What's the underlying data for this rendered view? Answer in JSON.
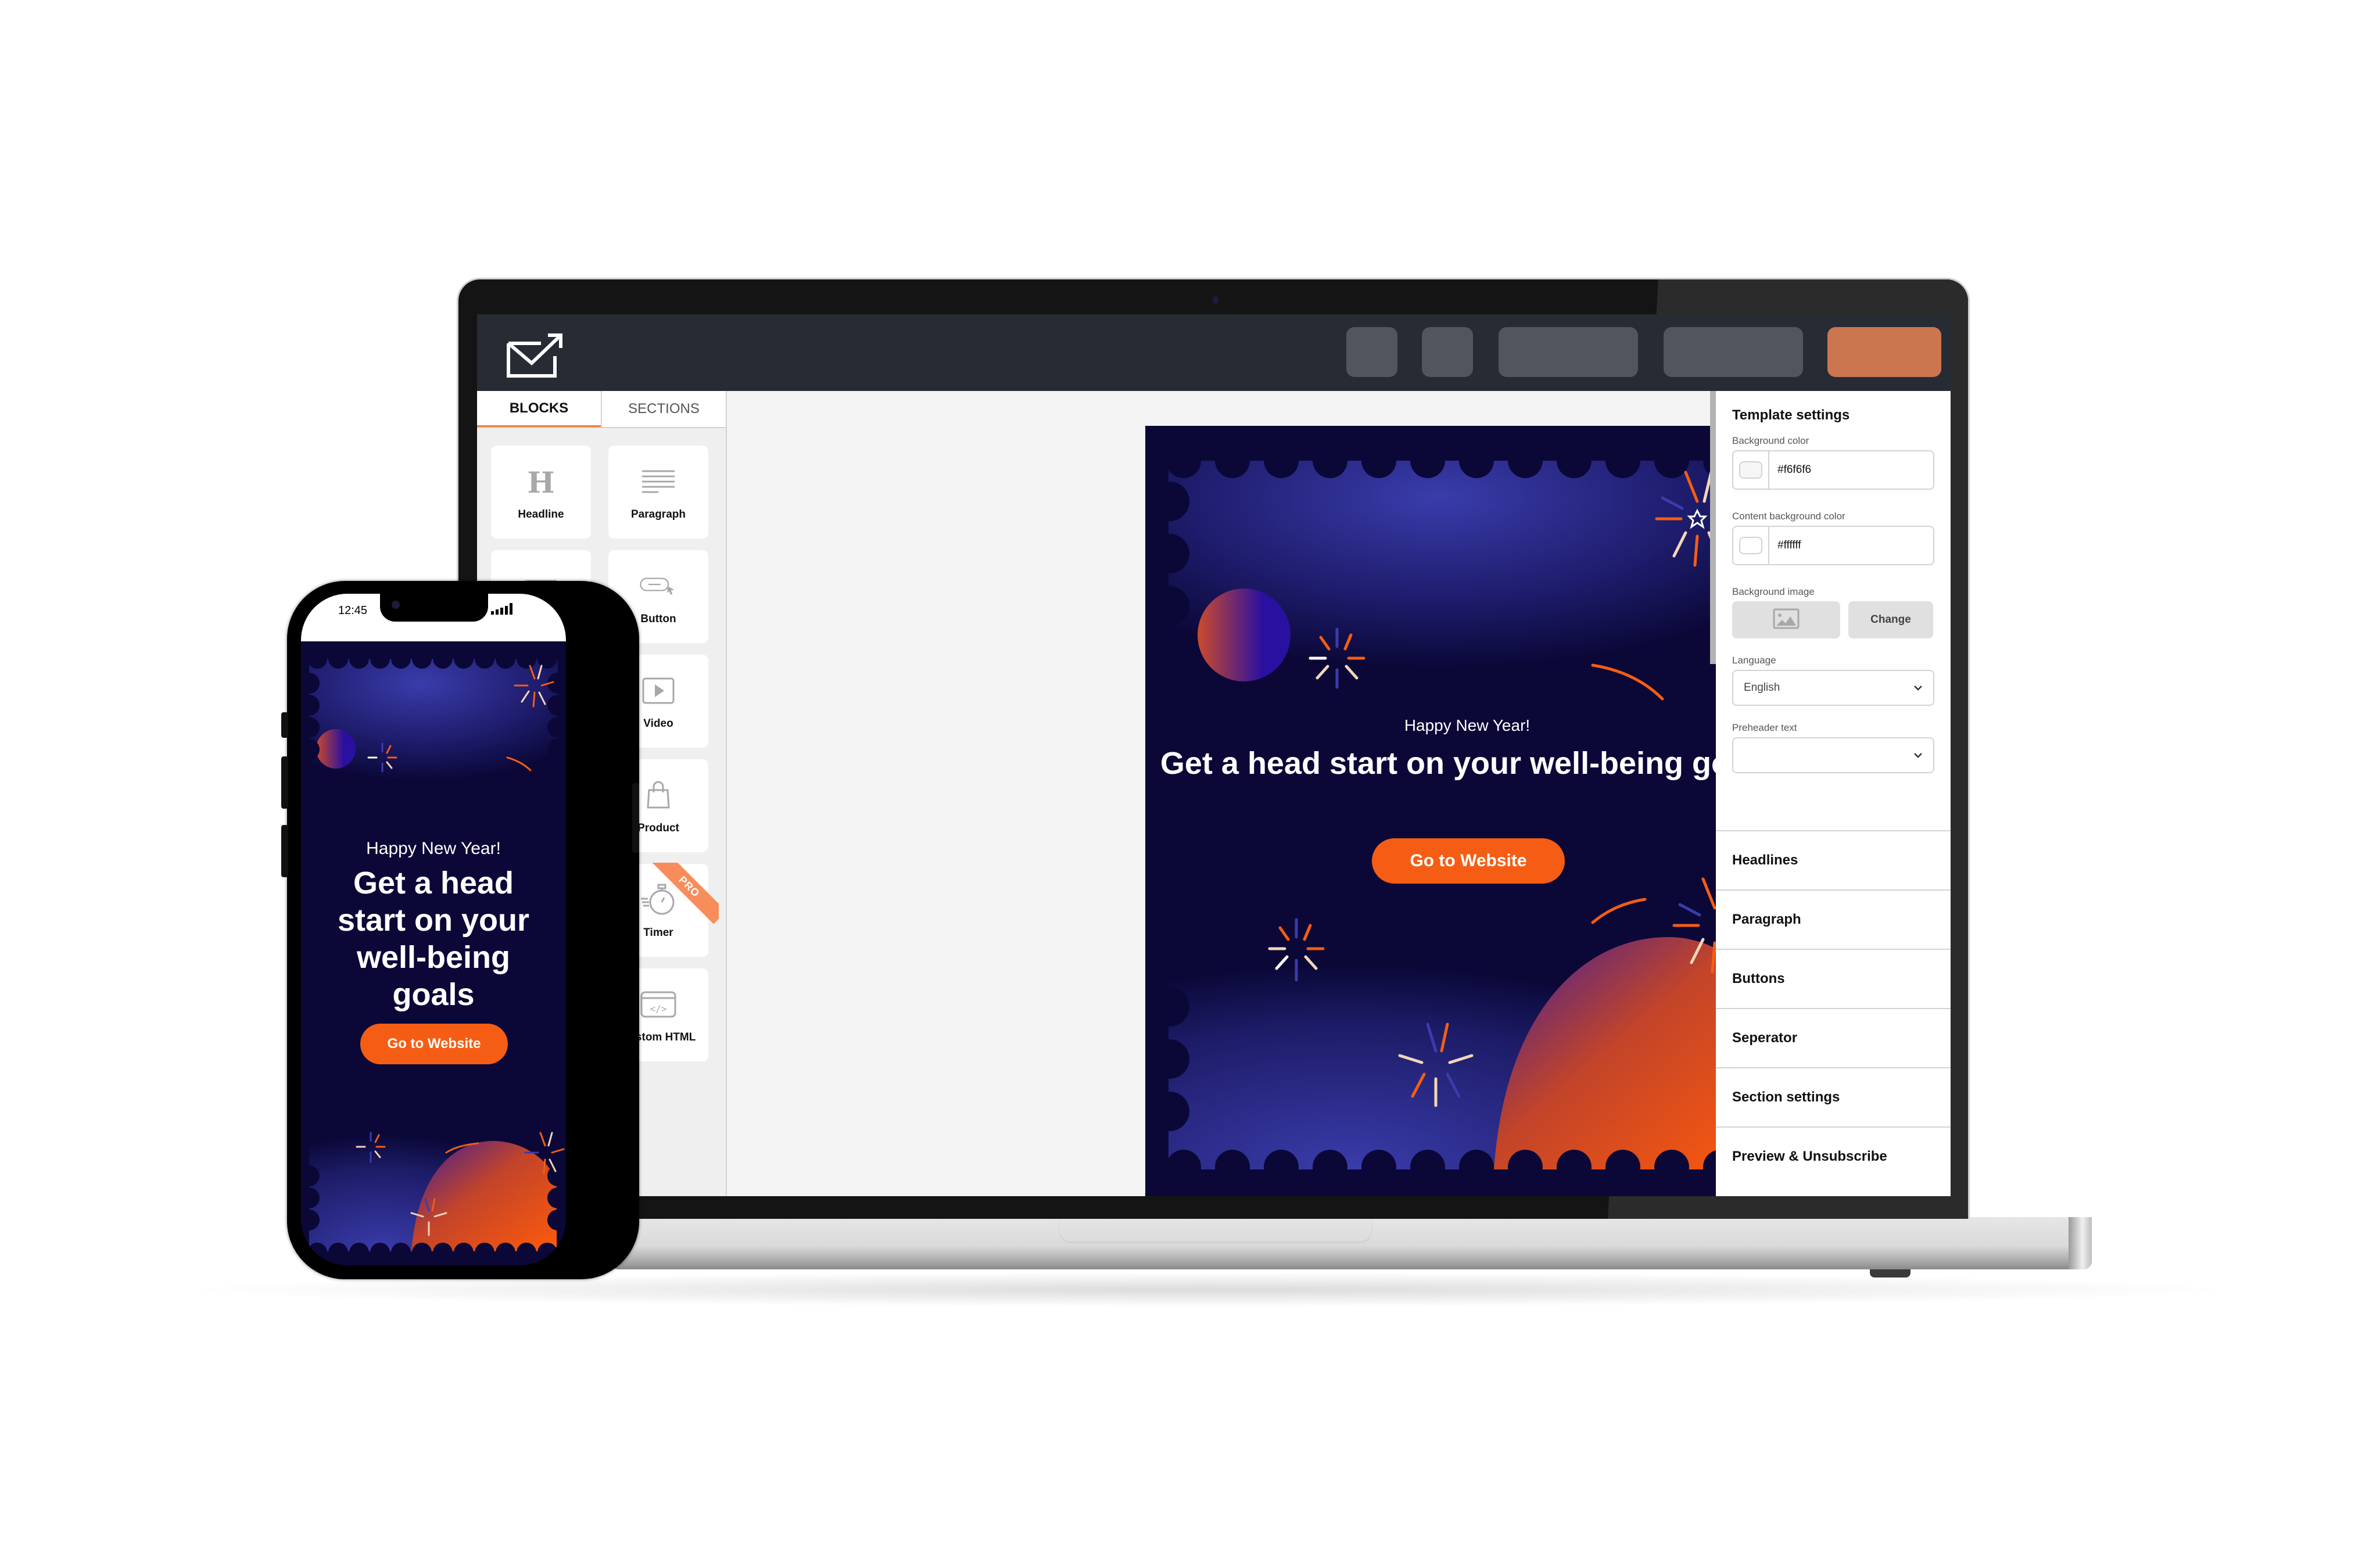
{
  "app": {
    "logo_icon": "envelope-send-icon",
    "toolbar_buttons": [
      {
        "label": "",
        "name": "toolbar-button-1"
      },
      {
        "label": "",
        "name": "toolbar-button-2"
      },
      {
        "label": "",
        "name": "toolbar-button-3"
      },
      {
        "label": "",
        "name": "toolbar-button-4"
      },
      {
        "label": "",
        "name": "toolbar-button-primary"
      }
    ],
    "colors": {
      "topbar": "#272b34",
      "accent": "#f37a3a",
      "primary_button": "#cc7650",
      "cta": "#f55d14",
      "email_bg": "#0b0838"
    }
  },
  "left_panel": {
    "tabs": [
      {
        "label": "BLOCKS",
        "active": true
      },
      {
        "label": "SECTIONS",
        "active": false
      }
    ],
    "blocks": [
      {
        "label": "Headline",
        "icon": "headline-icon"
      },
      {
        "label": "Paragraph",
        "icon": "paragraph-icon"
      },
      {
        "label": "",
        "icon": "image-icon"
      },
      {
        "label": "Button",
        "icon": "button-icon"
      },
      {
        "label": "",
        "icon": "block-icon"
      },
      {
        "label": "Video",
        "icon": "video-icon"
      },
      {
        "label": "",
        "icon": "block-icon"
      },
      {
        "label": "Product",
        "icon": "shopping-bag-icon"
      },
      {
        "label": "",
        "icon": "block-icon"
      },
      {
        "label": "Timer",
        "icon": "stopwatch-icon",
        "badge": "PRO"
      },
      {
        "label": "",
        "icon": "block-icon"
      },
      {
        "label": "Custom HTML",
        "icon": "code-icon"
      }
    ]
  },
  "email": {
    "greeting": "Happy New Year!",
    "headline": "Get a head start on your well-being goals",
    "cta_label": "Go to Website"
  },
  "right_panel": {
    "title": "Template settings",
    "background_color": {
      "label": "Background color",
      "value": "#f6f6f6"
    },
    "content_background_color": {
      "label": "Content background color",
      "value": "#ffffff"
    },
    "background_image": {
      "label": "Background image",
      "change_label": "Change"
    },
    "language": {
      "label": "Language",
      "value": "English"
    },
    "preheader": {
      "label": "Preheader text",
      "value": ""
    },
    "sections": [
      "Headlines",
      "Paragraph",
      "Buttons",
      "Seperator",
      "Section settings",
      "Preview & Unsubscribe"
    ]
  },
  "phone": {
    "time": "12:45",
    "greeting": "Happy New Year!",
    "headline": "Get a head start on your well-being goals",
    "cta_label": "Go to Website"
  }
}
